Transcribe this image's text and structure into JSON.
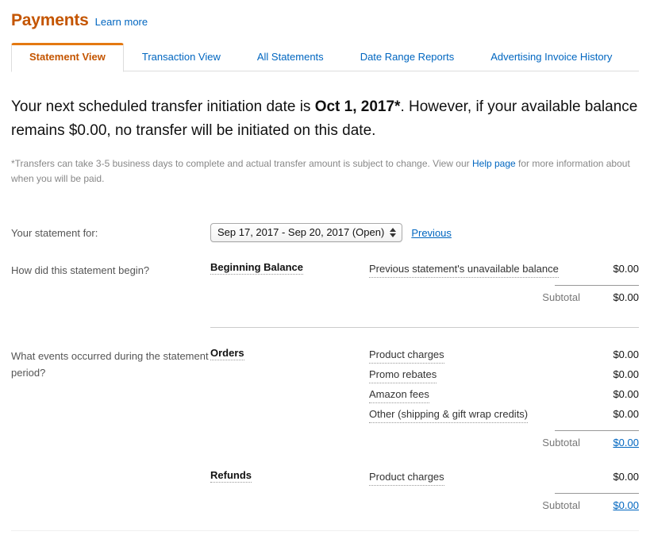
{
  "header": {
    "title": "Payments",
    "learn_more": "Learn more",
    "title_color": "#c45500",
    "link_color": "#0066c0"
  },
  "tabs": [
    {
      "label": "Statement View",
      "active": true
    },
    {
      "label": "Transaction View",
      "active": false
    },
    {
      "label": "All Statements",
      "active": false
    },
    {
      "label": "Date Range Reports",
      "active": false
    },
    {
      "label": "Advertising Invoice History",
      "active": false
    }
  ],
  "notice": {
    "part1": "Your next scheduled transfer initiation date is ",
    "bold": "Oct 1, 2017*",
    "part2": ". However, if your available balance remains $0.00, no transfer will be initiated on this date."
  },
  "footnote": {
    "part1": "*Transfers can take 3-5 business days to complete and actual transfer amount is subject to change. View our ",
    "link": "Help page",
    "part2": " for more information about when you will be paid."
  },
  "statement_selector": {
    "label": "Your statement for:",
    "selected": "Sep 17, 2017 - Sep 20, 2017 (Open)",
    "previous_label": "Previous"
  },
  "sections": [
    {
      "question": "How did this statement begin?",
      "groups": [
        {
          "name": "Beginning Balance",
          "lines": [
            {
              "label": "Previous statement's unavailable balance",
              "amount": "$0.00"
            }
          ],
          "subtotal_label": "Subtotal",
          "subtotal_amount": "$0.00",
          "subtotal_is_link": false
        }
      ]
    },
    {
      "question": "What events occurred during the statement period?",
      "groups": [
        {
          "name": "Orders",
          "lines": [
            {
              "label": "Product charges",
              "amount": "$0.00"
            },
            {
              "label": "Promo rebates",
              "amount": "$0.00"
            },
            {
              "label": "Amazon fees",
              "amount": "$0.00"
            },
            {
              "label": "Other (shipping & gift wrap credits)",
              "amount": "$0.00"
            }
          ],
          "subtotal_label": "Subtotal",
          "subtotal_amount": "$0.00",
          "subtotal_is_link": true
        },
        {
          "name": "Refunds",
          "lines": [
            {
              "label": "Product charges",
              "amount": "$0.00"
            }
          ],
          "subtotal_label": "Subtotal",
          "subtotal_amount": "$0.00",
          "subtotal_is_link": true
        }
      ]
    }
  ]
}
